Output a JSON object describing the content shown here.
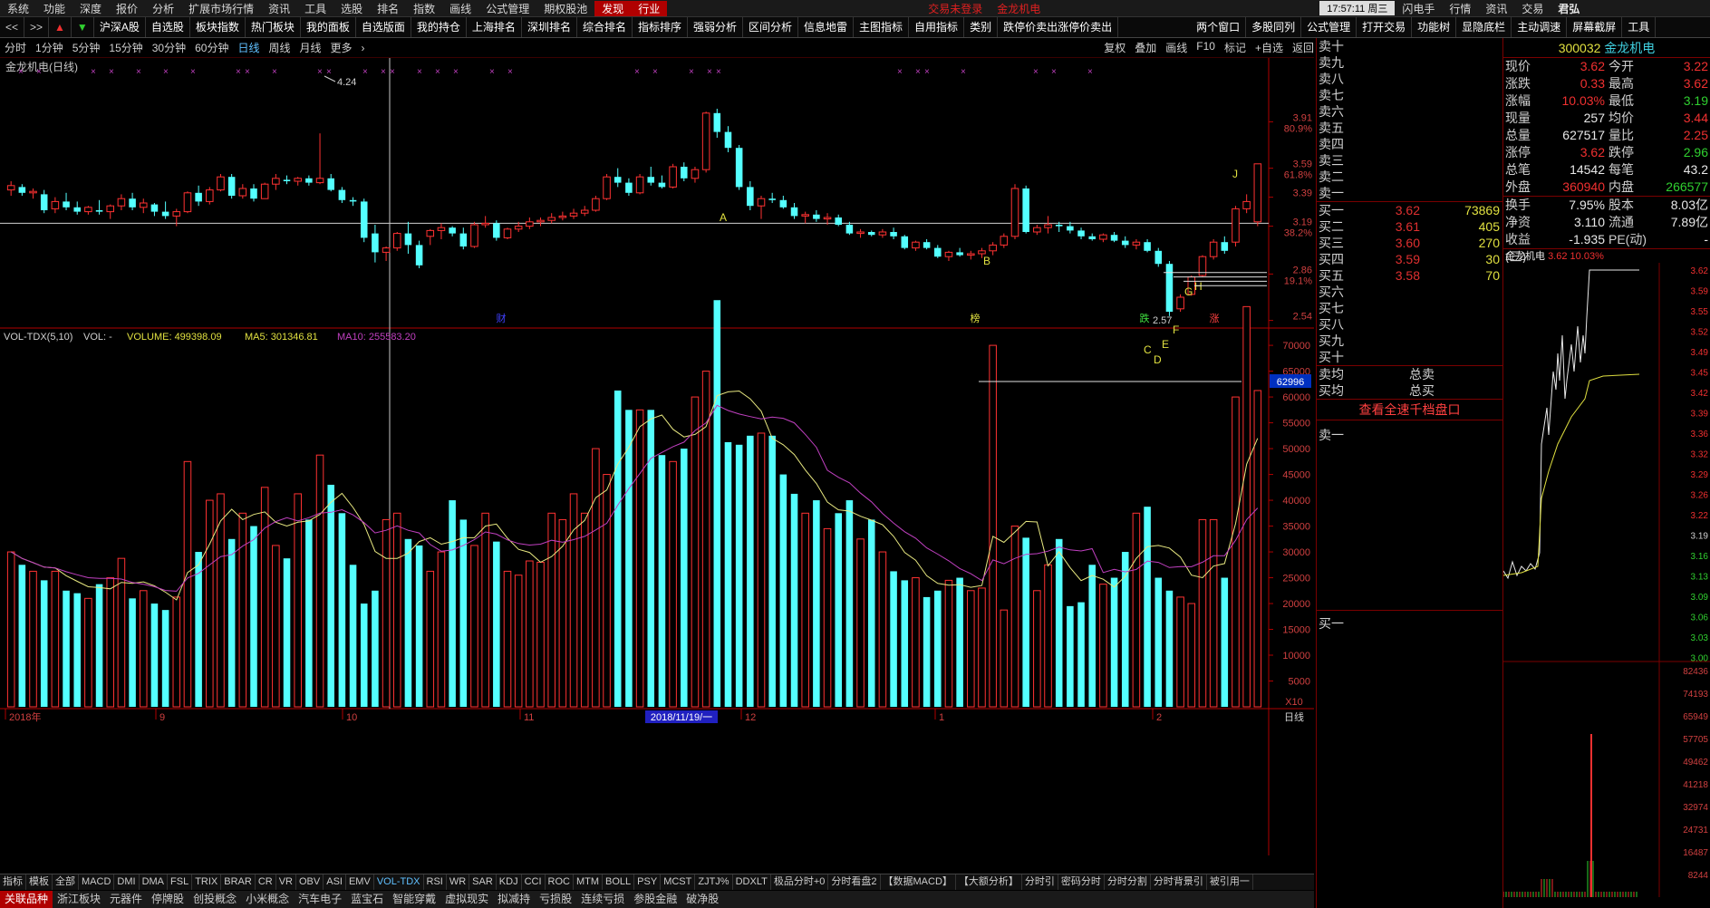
{
  "menu": {
    "items": [
      "系统",
      "功能",
      "深度",
      "报价",
      "分析",
      "扩展市场行情",
      "资讯",
      "工具",
      "选股",
      "排名",
      "指数",
      "画线",
      "公式管理",
      "期权股池"
    ],
    "discover": "发现",
    "industry": "行业",
    "status": "交易未登录",
    "stock_title": "金龙机电",
    "clock": "17:57:11 周三",
    "right_items": [
      "闪电手",
      "行情",
      "资讯",
      "交易"
    ],
    "brand": "君弘"
  },
  "toolbar": {
    "items": [
      "沪深A股",
      "自选股",
      "板块指数",
      "热门板块",
      "我的面板",
      "自选版面",
      "我的持仓",
      "上海排名",
      "深圳排名",
      "综合排名",
      "指标排序",
      "强弱分析",
      "区间分析",
      "信息地雷",
      "主图指标",
      "自用指标",
      "类别",
      "跌停价卖出涨停价卖出",
      "两个窗口",
      "多股同列",
      "公式管理",
      "打开交易",
      "功能树",
      "显隐底栏",
      "主动调速",
      "屏幕截屏",
      "工具"
    ]
  },
  "periods": {
    "items": [
      "分时",
      "1分钟",
      "5分钟",
      "15分钟",
      "30分钟",
      "日线",
      "周线",
      "月线",
      "更多"
    ],
    "active": "日线",
    "right": [
      "复权",
      "叠加",
      "画线",
      "F10",
      "标记",
      "+自选",
      "返回"
    ]
  },
  "chart": {
    "title": "金龙机电(日线)",
    "price_labels": [
      {
        "v": "3.91",
        "pct": "80.9%"
      },
      {
        "v": "3.59",
        "pct": "61.8%"
      },
      {
        "v": "3.39",
        "pct": ""
      },
      {
        "v": "3.19",
        "pct": "38.2%"
      },
      {
        "v": "2.86",
        "pct": "19.1%"
      },
      {
        "v": "2.54",
        "pct": ""
      }
    ],
    "price_ticks": [
      3.91,
      3.59,
      3.39,
      3.19,
      2.86,
      2.54
    ],
    "high_note": "4.24",
    "low_note": "2.57",
    "wave_labels": [
      "A",
      "B",
      "C",
      "D",
      "E",
      "F",
      "G",
      "H",
      "J"
    ],
    "event_tags": [
      "财",
      "榜",
      "跌",
      "涨"
    ],
    "vol_header": {
      "name": "VOL-TDX(5,10)",
      "vol": "VOL: -",
      "volume": "VOLUME: 499398.09",
      "ma5": "MA5: 301346.81",
      "ma10": "MA10: 255583.20"
    },
    "vol_ticks": [
      "70000",
      "65000",
      "60000",
      "55000",
      "50000",
      "45000",
      "40000",
      "35000",
      "30000",
      "25000",
      "20000",
      "15000",
      "10000",
      "5000"
    ],
    "vol_max_tag": "62996",
    "vol_unit": "X10",
    "date_labels": [
      "2018年",
      "9",
      "10",
      "11",
      "12",
      "1",
      "2"
    ],
    "date_highlight": "2018/11/19/一",
    "period_right": "日线"
  },
  "indicators": {
    "items": [
      "指标",
      "模板",
      "全部",
      "MACD",
      "DMI",
      "DMA",
      "FSL",
      "TRIX",
      "BRAR",
      "CR",
      "VR",
      "OBV",
      "ASI",
      "EMV",
      "VOL-TDX",
      "RSI",
      "WR",
      "SAR",
      "KDJ",
      "CCI",
      "ROC",
      "MTM",
      "BOLL",
      "PSY",
      "MCST",
      "ZJTJ%",
      "DDXLT",
      "极品分时+0",
      "分时看盘2",
      "【数据MACD】",
      "【大额分析】",
      "分时引",
      "密码分时",
      "分时分割",
      "分时背景引",
      "被引用一"
    ],
    "active": "VOL-TDX"
  },
  "blocks": {
    "items": [
      "关联品种",
      "浙江板块",
      "元器件",
      "停牌股",
      "创投概念",
      "小米概念",
      "汽车电子",
      "蓝宝石",
      "智能穿戴",
      "虚拟现实",
      "拟减持",
      "亏损股",
      "连续亏损",
      "参股金融",
      "破净股"
    ]
  },
  "orderbook": {
    "asks": [
      {
        "label": "卖十",
        "price": "",
        "vol": ""
      },
      {
        "label": "卖九",
        "price": "",
        "vol": ""
      },
      {
        "label": "卖八",
        "price": "",
        "vol": ""
      },
      {
        "label": "卖七",
        "price": "",
        "vol": ""
      },
      {
        "label": "卖六",
        "price": "",
        "vol": ""
      },
      {
        "label": "卖五",
        "price": "",
        "vol": ""
      },
      {
        "label": "卖四",
        "price": "",
        "vol": ""
      },
      {
        "label": "卖三",
        "price": "",
        "vol": ""
      },
      {
        "label": "卖二",
        "price": "",
        "vol": ""
      },
      {
        "label": "卖一",
        "price": "",
        "vol": ""
      }
    ],
    "bids": [
      {
        "label": "买一",
        "price": "3.62",
        "vol": "73869"
      },
      {
        "label": "买二",
        "price": "3.61",
        "vol": "405"
      },
      {
        "label": "买三",
        "price": "3.60",
        "vol": "270"
      },
      {
        "label": "买四",
        "price": "3.59",
        "vol": "30"
      },
      {
        "label": "买五",
        "price": "3.58",
        "vol": "70"
      },
      {
        "label": "买六",
        "price": "",
        "vol": ""
      },
      {
        "label": "买七",
        "price": "",
        "vol": ""
      },
      {
        "label": "买八",
        "price": "",
        "vol": ""
      },
      {
        "label": "买九",
        "price": "",
        "vol": ""
      },
      {
        "label": "买十",
        "price": "",
        "vol": ""
      }
    ],
    "sell_avg": "卖均",
    "buy_avg": "买均",
    "total_sell": "总卖",
    "total_buy": "总买",
    "link": "查看全速千档盘口",
    "queue_ask": "卖一",
    "queue_bid": "买一"
  },
  "quote": {
    "code": "300032",
    "name": "金龙机电",
    "rows": [
      {
        "a": "现价",
        "b": "3.62",
        "bc": "red",
        "c": "今开",
        "d": "3.22",
        "dc": "red"
      },
      {
        "a": "涨跌",
        "b": "0.33",
        "bc": "red",
        "c": "最高",
        "d": "3.62",
        "dc": "red"
      },
      {
        "a": "涨幅",
        "b": "10.03%",
        "bc": "red",
        "c": "最低",
        "d": "3.19",
        "dc": "grn"
      },
      {
        "a": "现量",
        "b": "257",
        "bc": "wht",
        "c": "均价",
        "d": "3.44",
        "dc": "red"
      },
      {
        "a": "总量",
        "b": "627517",
        "bc": "wht",
        "c": "量比",
        "d": "2.25",
        "dc": "red"
      },
      {
        "a": "涨停",
        "b": "3.62",
        "bc": "red",
        "c": "跌停",
        "d": "2.96",
        "dc": "grn"
      },
      {
        "a": "总笔",
        "b": "14542",
        "bc": "wht",
        "c": "每笔",
        "d": "43.2",
        "dc": "wht"
      },
      {
        "a": "外盘",
        "b": "360940",
        "bc": "red",
        "c": "内盘",
        "d": "266577",
        "dc": "grn"
      },
      {
        "a": "换手",
        "b": "7.95%",
        "bc": "wht",
        "c": "股本",
        "d": "8.03亿",
        "dc": "wht"
      },
      {
        "a": "净资",
        "b": "3.110",
        "bc": "wht",
        "c": "流通",
        "d": "7.89亿",
        "dc": "wht"
      },
      {
        "a": "收益(三)",
        "b": "-1.935",
        "bc": "wht",
        "c": "PE(动)",
        "d": "-",
        "dc": "wht"
      }
    ],
    "mini_title": "金龙机电",
    "mini_price": "3.62",
    "mini_pct": "10.03%",
    "mini_ticks": [
      "3.62",
      "3.59",
      "3.55",
      "3.52",
      "3.49",
      "3.45",
      "3.42",
      "3.39",
      "3.36",
      "3.32",
      "3.29",
      "3.26",
      "3.22",
      "3.19",
      "3.16",
      "3.13",
      "3.09",
      "3.06",
      "3.03",
      "3.00"
    ],
    "mini_vol_ticks": [
      "82436",
      "74193",
      "65949",
      "57705",
      "49462",
      "41218",
      "32974",
      "24731",
      "16487",
      "8244"
    ]
  },
  "colors": {
    "up": "#ff3232",
    "down": "#54ffff",
    "ma5": "#e8e880",
    "ma10": "#c040c0",
    "grid": "#7a0000",
    "axis": "#b00000"
  }
}
